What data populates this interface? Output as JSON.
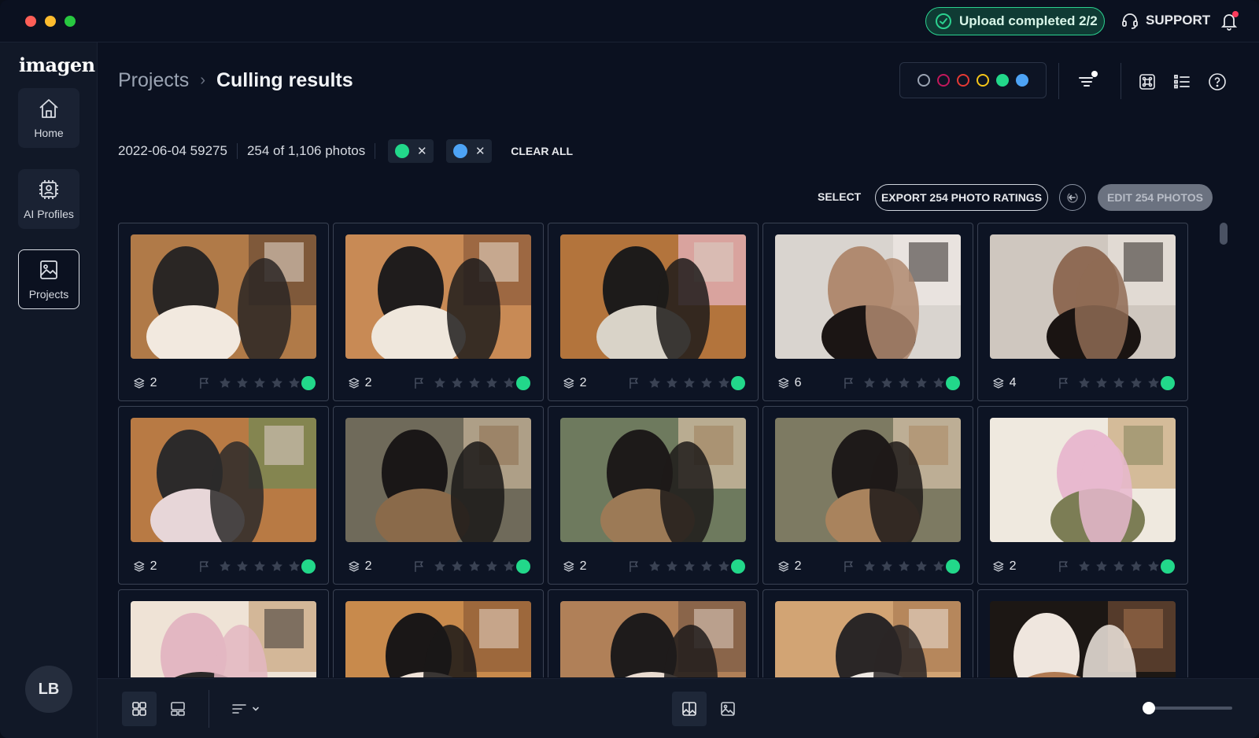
{
  "titlebar": {
    "upload_status": "Upload completed 2/2",
    "support_label": "SUPPORT"
  },
  "sidebar": {
    "logo": "imagen",
    "items": [
      {
        "label": "Home",
        "icon": "home-icon"
      },
      {
        "label": "AI Profiles",
        "icon": "ai-profile-icon"
      },
      {
        "label": "Projects",
        "icon": "projects-icon",
        "active": true
      }
    ],
    "avatar_initials": "LB"
  },
  "breadcrumb": {
    "parent": "Projects",
    "current": "Culling results"
  },
  "color_filters": [
    {
      "color": "#9aa3b2",
      "selected": false
    },
    {
      "color": "#c2185b",
      "selected": false
    },
    {
      "color": "#e53935",
      "selected": false
    },
    {
      "color": "#f5c518",
      "selected": false
    },
    {
      "color": "#22d88a",
      "selected": true
    },
    {
      "color": "#4da3f5",
      "selected": true
    }
  ],
  "filters": {
    "project": "2022-06-04 59275",
    "count": "254 of 1,106 photos",
    "chips": [
      {
        "color": "#22d88a"
      },
      {
        "color": "#4da3f5"
      }
    ],
    "chip_remove_glyph": "✕",
    "clear_all": "CLEAR ALL"
  },
  "actions": {
    "select": "SELECT",
    "export": "EXPORT 254 PHOTO RATINGS",
    "edit": "EDIT 254 PHOTOS"
  },
  "photos": [
    {
      "stack": "2",
      "status": "#22d88a",
      "palette": [
        "#b07a48",
        "#f2e9df",
        "#2a2624",
        "#6b4b34"
      ]
    },
    {
      "stack": "2",
      "status": "#22d88a",
      "palette": [
        "#c88a55",
        "#efe7dc",
        "#1f1c1c",
        "#8a5a3a"
      ]
    },
    {
      "stack": "2",
      "status": "#22d88a",
      "palette": [
        "#b3743c",
        "#d9d3c8",
        "#1d1b1a",
        "#e9b8c8"
      ]
    },
    {
      "stack": "6",
      "status": "#22d88a",
      "palette": [
        "#d9d4cf",
        "#1b1514",
        "#b08a70",
        "#efeae6"
      ]
    },
    {
      "stack": "4",
      "status": "#22d88a",
      "palette": [
        "#cfc7bf",
        "#1a1412",
        "#8f6b55",
        "#e8e2dc"
      ]
    },
    {
      "stack": "2",
      "status": "#22d88a",
      "palette": [
        "#b87a44",
        "#e7d6d8",
        "#2c2a2a",
        "#6e8a55"
      ]
    },
    {
      "stack": "2",
      "status": "#22d88a",
      "palette": [
        "#6f6a5a",
        "#8a6a4a",
        "#1a1717",
        "#c9b79a"
      ]
    },
    {
      "stack": "2",
      "status": "#22d88a",
      "palette": [
        "#6e7a5e",
        "#9c7a56",
        "#1d1a19",
        "#d8c2a6"
      ]
    },
    {
      "stack": "2",
      "status": "#22d88a",
      "palette": [
        "#7d7a62",
        "#a9835d",
        "#1e1a19",
        "#d9c5ab"
      ]
    },
    {
      "stack": "2",
      "status": "#22d88a",
      "palette": [
        "#efe9df",
        "#7c7d55",
        "#e8b9cf",
        "#c9a77a"
      ]
    },
    {
      "stack": "",
      "status": "#22d88a",
      "palette": [
        "#efe3d6",
        "#2a2828",
        "#e3b7c2",
        "#c8a47e"
      ]
    },
    {
      "stack": "",
      "status": "#22d88a",
      "palette": [
        "#c88a4c",
        "#efe2d8",
        "#1a1717",
        "#8a5a36"
      ]
    },
    {
      "stack": "",
      "status": "#22d88a",
      "palette": [
        "#b08058",
        "#e9dbd0",
        "#1e1b1b",
        "#7a5a44"
      ]
    },
    {
      "stack": "",
      "status": "#22d88a",
      "palette": [
        "#d2a474",
        "#efe9e3",
        "#2a2626",
        "#a97a52"
      ]
    },
    {
      "stack": "",
      "status": "#22d88a",
      "palette": [
        "#1c1714",
        "#b07a52",
        "#efe6de",
        "#6e4b34"
      ]
    }
  ],
  "bottombar": {
    "zoom_level": 0.05
  }
}
